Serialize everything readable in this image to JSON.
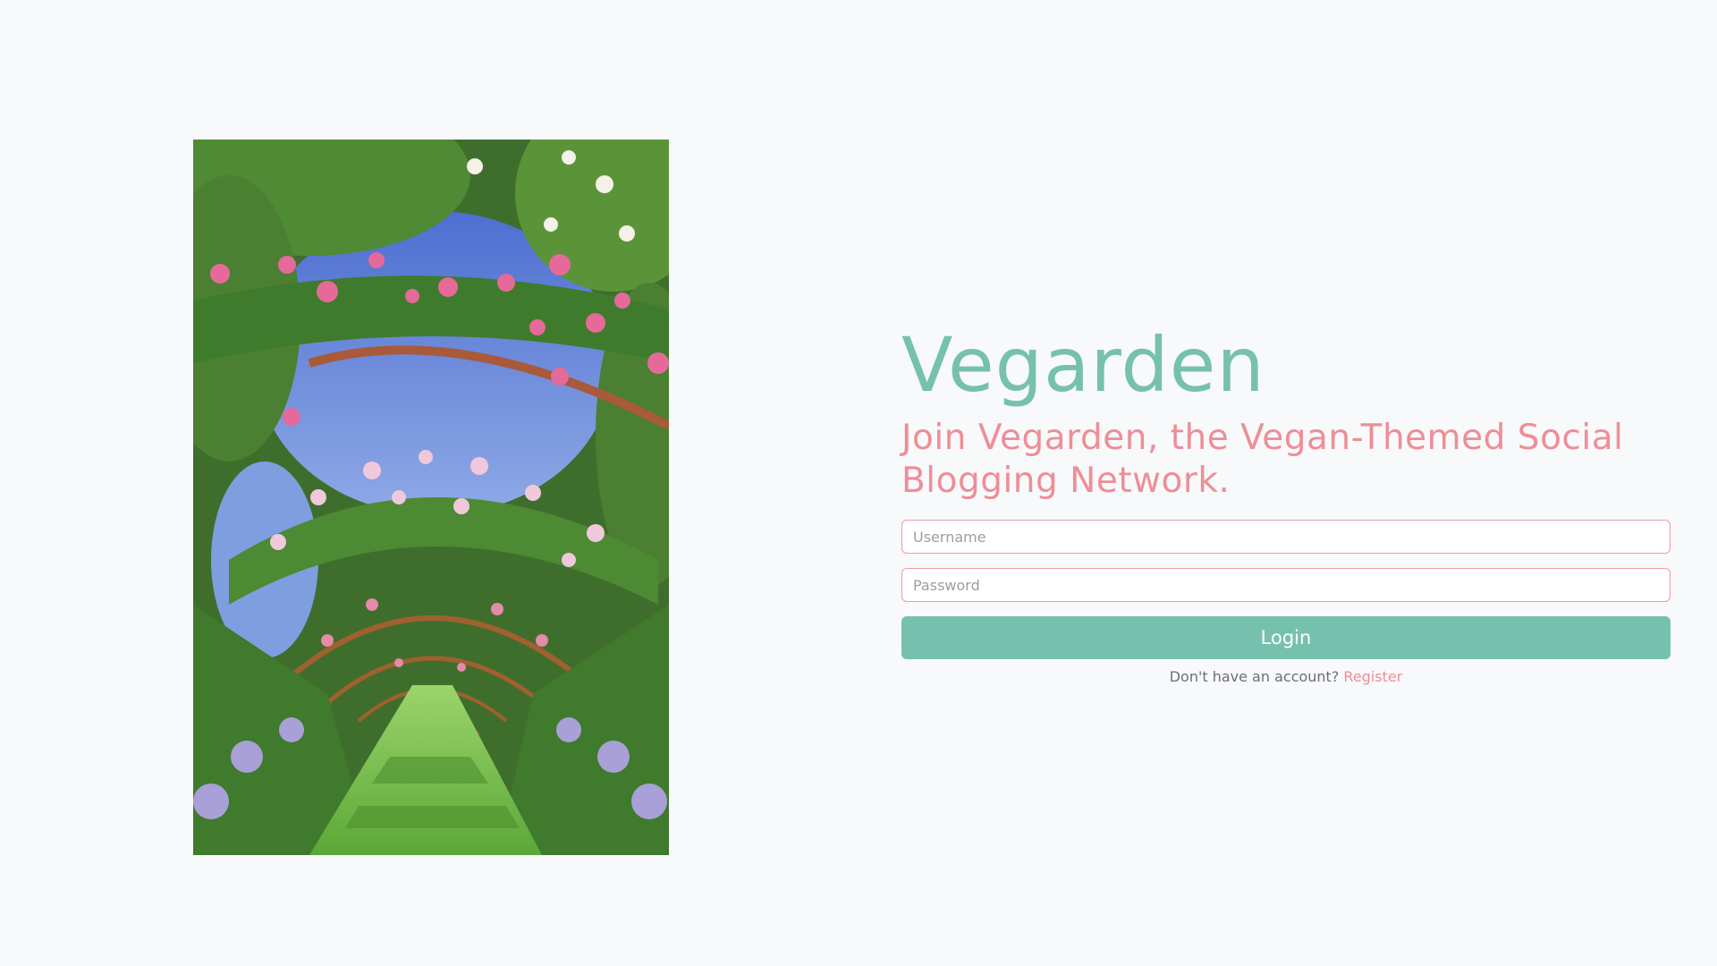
{
  "brand": {
    "title": "Vegarden",
    "color": "#76c1ad"
  },
  "tagline": {
    "text": "Join Vegarden, the Vegan-Themed Social Blogging Network.",
    "color": "#ee8e97"
  },
  "form": {
    "username_placeholder": "Username",
    "username_value": "",
    "password_placeholder": "Password",
    "password_value": "",
    "login_label": "Login"
  },
  "register": {
    "prompt": "Don't have an account?",
    "link_label": "Register"
  },
  "image": {
    "subject": "rose-arch-garden-path-photo"
  },
  "colors": {
    "background": "#f8f9fa",
    "accent_green": "#76c1ad",
    "accent_pink": "#ee8e97"
  }
}
